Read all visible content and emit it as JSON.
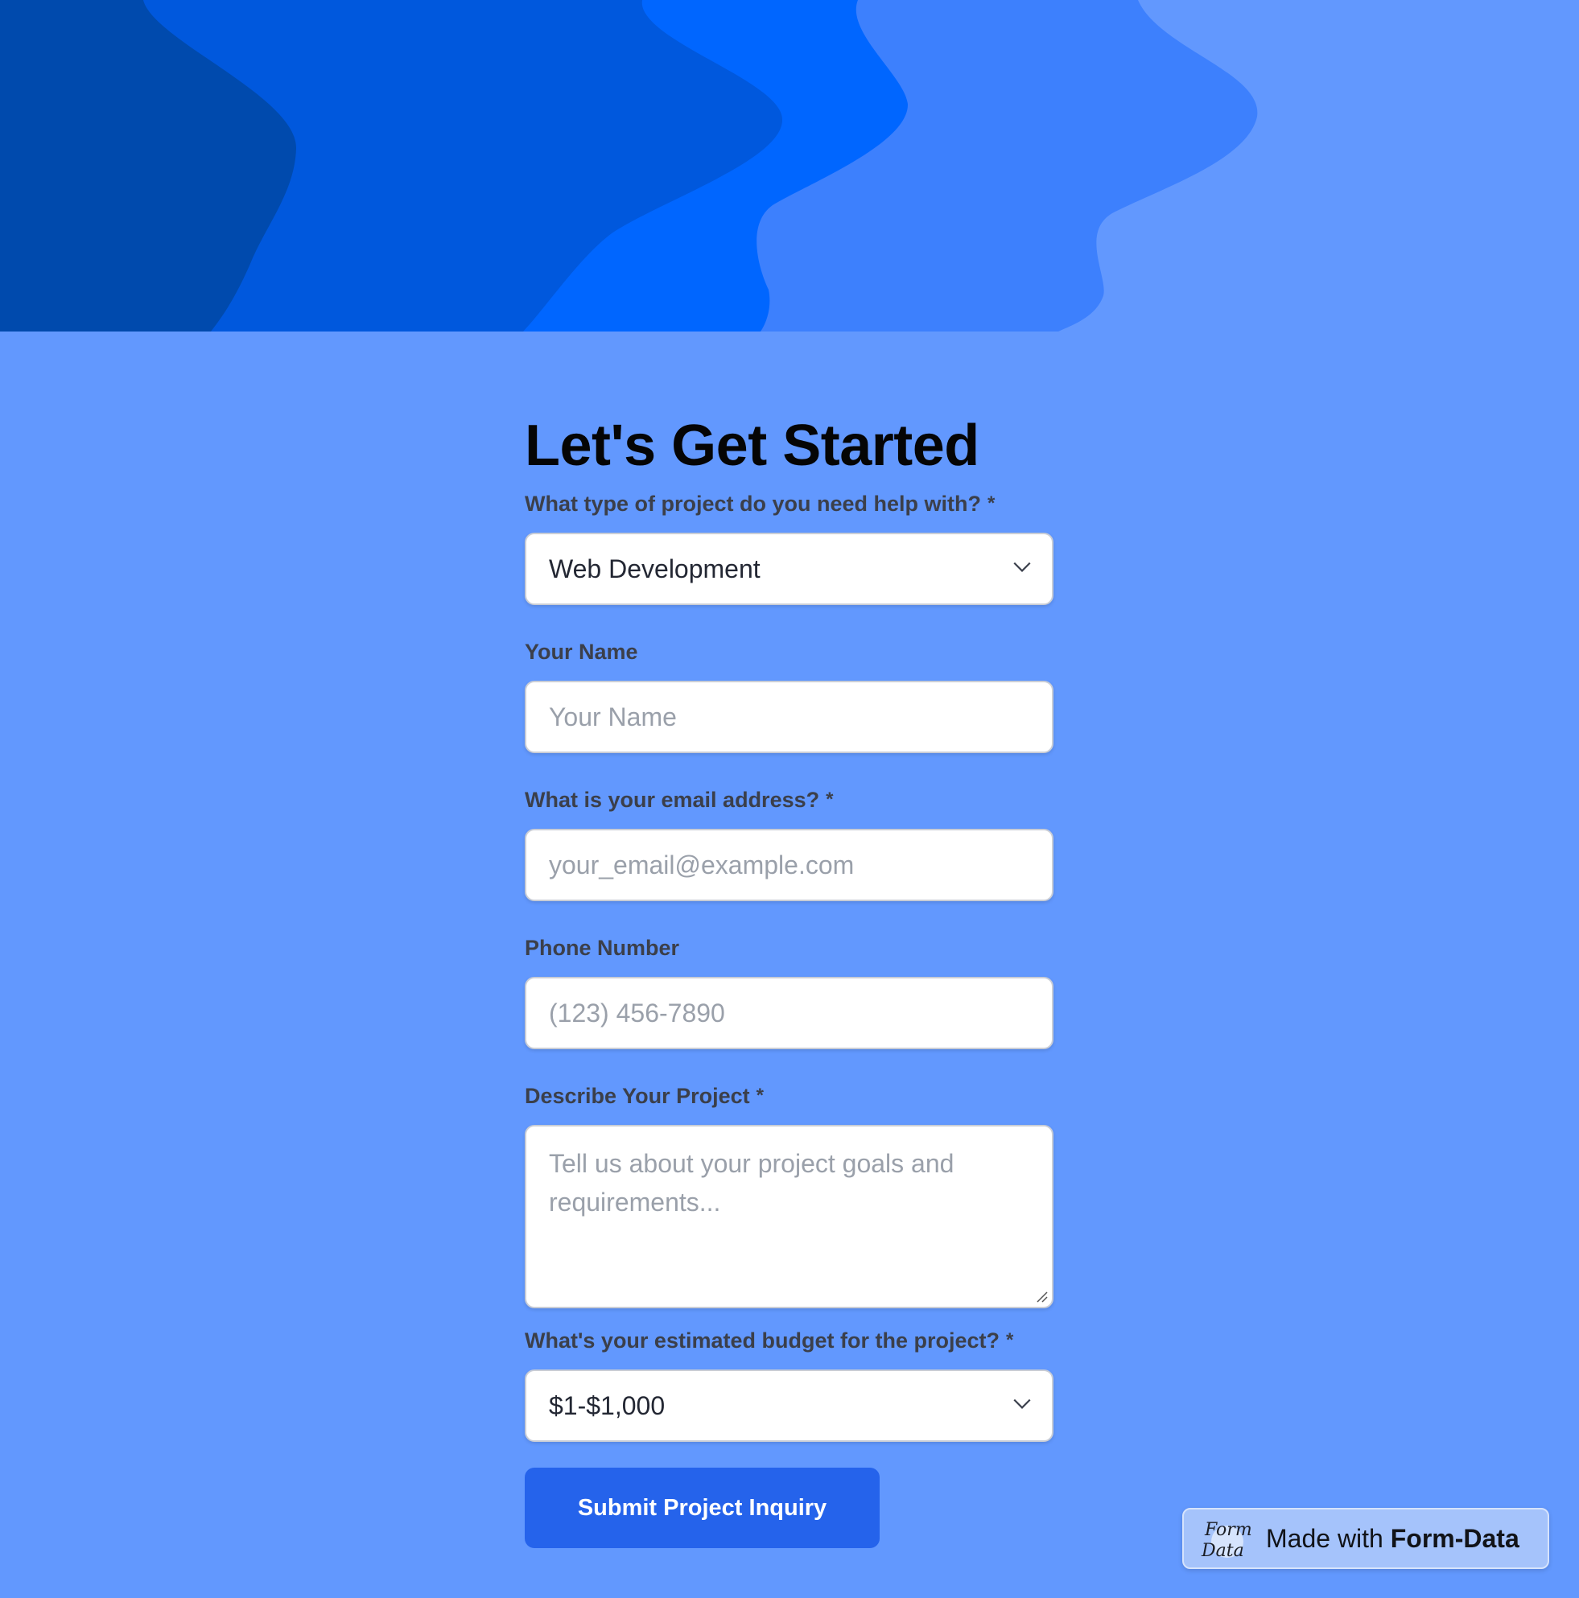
{
  "header": {
    "wave_colors": [
      "#004aad",
      "#0058dd",
      "#0066ff",
      "#3d80fd",
      "#6298fe"
    ]
  },
  "form": {
    "title": "Let's Get Started",
    "required_mark": "*",
    "project_type": {
      "label": "What type of project do you need help with?",
      "required": true,
      "value": "Web Development"
    },
    "name": {
      "label": "Your Name",
      "required": false,
      "placeholder": "Your Name"
    },
    "email": {
      "label": "What is your email address?",
      "required": true,
      "placeholder": "your_email@example.com"
    },
    "phone": {
      "label": "Phone Number",
      "required": false,
      "placeholder": "(123) 456-7890"
    },
    "description": {
      "label": "Describe Your Project",
      "required": true,
      "placeholder": "Tell us about your project goals and requirements..."
    },
    "budget": {
      "label": "What's your estimated budget for the project?",
      "required": true,
      "value": "$1-$1,000"
    },
    "submit_label": "Submit Project Inquiry"
  },
  "badge": {
    "prefix": "Made with",
    "brand": "Form-Data",
    "logo_text": "Form Data"
  },
  "colors": {
    "background": "#6298fe",
    "submit_button": "#2563eb",
    "title": "#050505",
    "label": "#3b3f4a"
  },
  "icons": {
    "dropdown": "chevron-down-icon",
    "resize": "resize-grip-icon"
  }
}
